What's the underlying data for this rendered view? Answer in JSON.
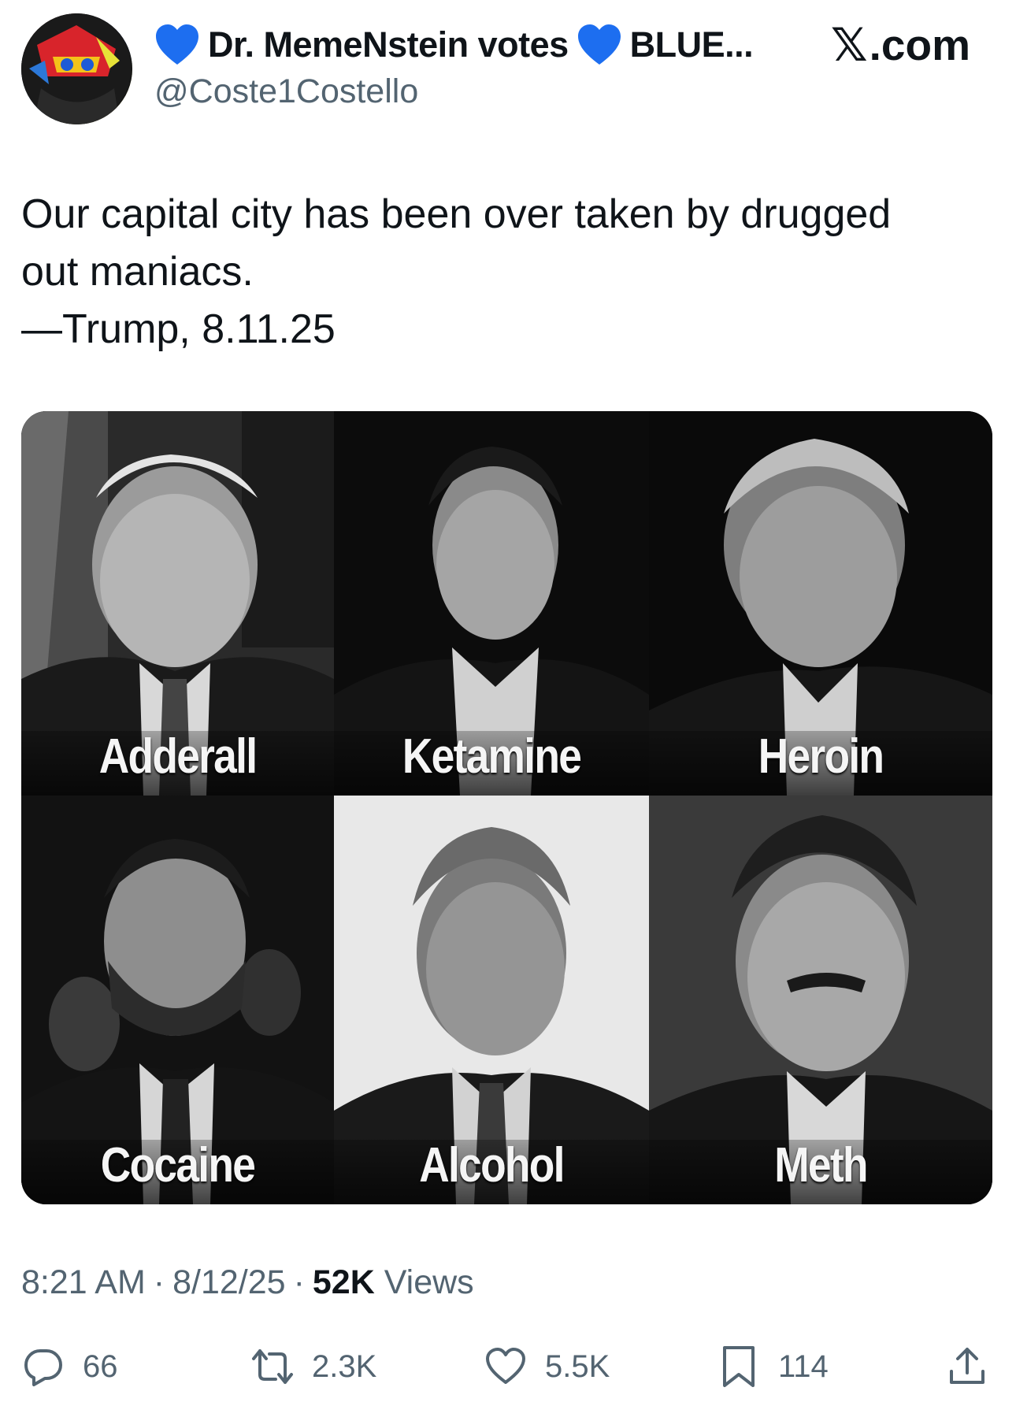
{
  "author": {
    "display_name": "Dr. MemeNstein votes",
    "name_suffix": "BLUE...",
    "handle": "@Coste1Costello",
    "avatar_icon": "avatar-image",
    "badge_icon": "blue-heart-icon",
    "badge_color": "#1d6ef0"
  },
  "site": {
    "logo_glyph": "𝕏",
    "domain_suffix": ".com"
  },
  "tweet": {
    "lines": [
      "Our capital city has been over taken by drugged",
      "out maniacs.",
      "—Trump, 8.11.25"
    ]
  },
  "media": {
    "panels": [
      {
        "caption": "Adderall"
      },
      {
        "caption": "Ketamine"
      },
      {
        "caption": "Heroin"
      },
      {
        "caption": "Cocaine"
      },
      {
        "caption": "Alcohol"
      },
      {
        "caption": "Meth"
      }
    ]
  },
  "meta": {
    "time": "8:21 AM",
    "separator": "·",
    "date": "8/12/25",
    "views_count": "52K",
    "views_label": "Views"
  },
  "actions": {
    "replies": {
      "icon": "reply-icon",
      "count": "66"
    },
    "reposts": {
      "icon": "repost-icon",
      "count": "2.3K"
    },
    "likes": {
      "icon": "heart-icon",
      "count": "5.5K"
    },
    "bookmarks": {
      "icon": "bookmark-icon",
      "count": "114"
    },
    "share": {
      "icon": "share-icon"
    }
  },
  "colors": {
    "text_primary": "#0f1419",
    "text_secondary": "#536471",
    "badge_blue": "#1d6ef0"
  }
}
